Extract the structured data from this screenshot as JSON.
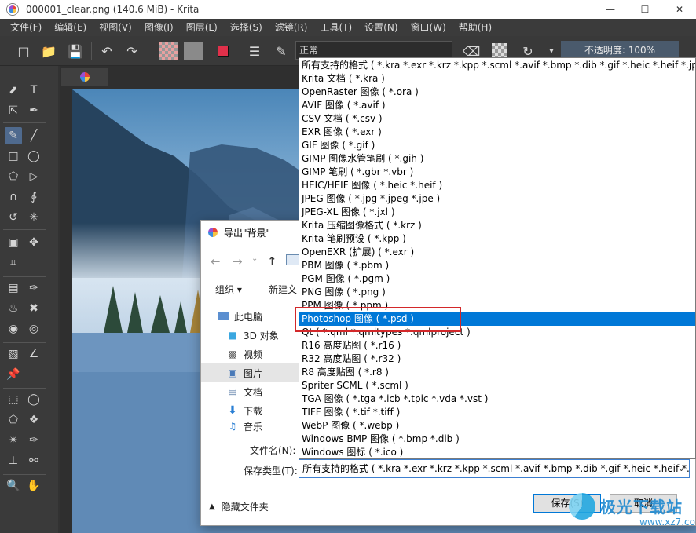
{
  "window": {
    "title": "000001_clear.png (140.6 MiB)  - Krita"
  },
  "menubar": {
    "items": [
      "文件(F)",
      "编辑(E)",
      "视图(V)",
      "图像(I)",
      "图层(L)",
      "选择(S)",
      "滤镜(R)",
      "工具(T)",
      "设置(N)",
      "窗口(W)",
      "帮助(H)"
    ]
  },
  "toolbar": {
    "blend_mode": "正常",
    "opacity_label": "不透明度: 100%"
  },
  "dialog": {
    "title": "导出\"背景\"",
    "organize_label": "组织 ▾",
    "new_folder_label": "新建文",
    "tree": [
      {
        "label": "此电脑",
        "icon": "computer-icon"
      },
      {
        "label": "3D 对象",
        "icon": "cube-icon"
      },
      {
        "label": "视频",
        "icon": "video-icon"
      },
      {
        "label": "图片",
        "icon": "pictures-icon"
      },
      {
        "label": "文档",
        "icon": "document-icon"
      },
      {
        "label": "下载",
        "icon": "download-icon"
      },
      {
        "label": "音乐",
        "icon": "music-icon"
      }
    ],
    "filename_label": "文件名(N):",
    "filetype_label": "保存类型(T):",
    "filetype_value": "所有支持的格式 ( *.kra *.exr *.krz *.kpp *.scml *.avif *.bmp *.dib *.gif *.heic *.heif *.jpg *.jpeg",
    "hide_folders_label": "隐藏文件夹",
    "save_button": "保存(S)",
    "cancel_button": "取消"
  },
  "dropdown": {
    "selected_index": 19,
    "items": [
      "所有支持的格式 ( *.kra *.exr *.krz *.kpp *.scml *.avif *.bmp *.dib *.gif *.heic *.heif *.jpg *.jpeg",
      "Krita 文档 ( *.kra )",
      "OpenRaster 图像 ( *.ora )",
      "AVIF 图像 ( *.avif )",
      "CSV 文档 ( *.csv )",
      "EXR 图像 ( *.exr )",
      "GIF 图像 ( *.gif )",
      "GIMP 图像水管笔刷 ( *.gih )",
      "GIMP 笔刷 ( *.gbr *.vbr )",
      "HEIC/HEIF 图像 ( *.heic *.heif )",
      "JPEG 图像 ( *.jpg *.jpeg *.jpe )",
      "JPEG-XL 图像 ( *.jxl )",
      "Krita 压缩图像格式 ( *.krz )",
      "Krita 笔刷预设 ( *.kpp )",
      "OpenEXR (扩展) ( *.exr )",
      "PBM 图像 ( *.pbm )",
      "PGM 图像 ( *.pgm )",
      "PNG 图像 ( *.png )",
      "PPM 图像 ( *.ppm )",
      "Photoshop 图像 ( *.psd )",
      "Qt ( *.qml *.qmltypes *.qmlproject )",
      "R16 高度贴图 ( *.r16 )",
      "R32 高度贴图 ( *.r32 )",
      "R8 高度贴图 ( *.r8 )",
      "Spriter SCML ( *.scml )",
      "TGA 图像 ( *.tga *.icb *.tpic *.vda *.vst )",
      "TIFF 图像 ( *.tif *.tiff )",
      "WebP 图像 ( *.webp )",
      "Windows BMP 图像 ( *.bmp *.dib )",
      "Windows 图标 ( *.ico )"
    ]
  },
  "watermark": {
    "text": "极光下载站",
    "url": "www.xz7.com"
  },
  "colors": {
    "accent": "#0078d7",
    "highlight_box": "#d3282a",
    "krita_dark": "#3a3a3a"
  }
}
